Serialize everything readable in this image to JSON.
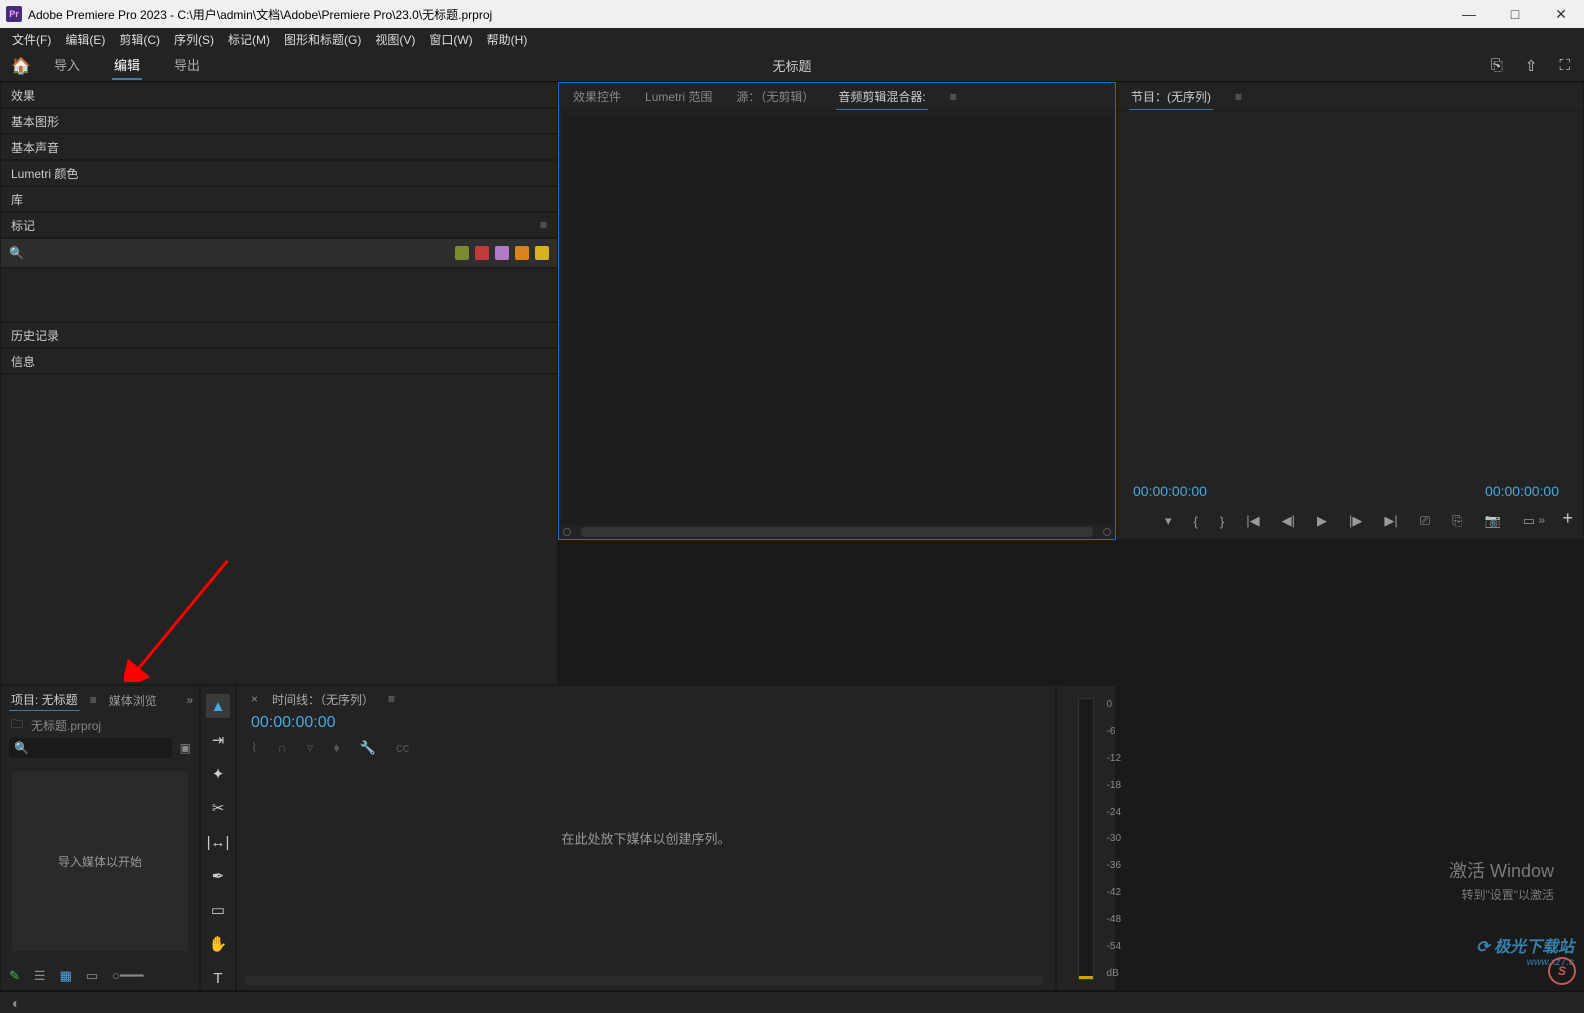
{
  "window": {
    "app_badge": "Pr",
    "title": "Adobe Premiere Pro 2023 - C:\\用户\\admin\\文档\\Adobe\\Premiere Pro\\23.0\\无标题.prproj"
  },
  "menus": [
    "文件(F)",
    "编辑(E)",
    "剪辑(C)",
    "序列(S)",
    "标记(M)",
    "图形和标题(G)",
    "视图(V)",
    "窗口(W)",
    "帮助(H)"
  ],
  "topbar": {
    "tabs": [
      "导入",
      "编辑",
      "导出"
    ],
    "active_index": 1,
    "project_title": "无标题"
  },
  "source_panel": {
    "tabs": [
      "效果控件",
      "Lumetri 范围",
      "源：（无剪辑）",
      "音频剪辑混合器:"
    ],
    "active_index": 3
  },
  "program_panel": {
    "title": "节目：(无序列)",
    "timecode_left": "00:00:00:00",
    "timecode_right": "00:00:00:00"
  },
  "right_panels": {
    "items": [
      "效果",
      "基本图形",
      "基本声音",
      "Lumetri 颜色",
      "库",
      "标记"
    ],
    "markers_colors": [
      "#7a8c2f",
      "#c23b3b",
      "#b37bc7",
      "#d8841a",
      "#d6b21f"
    ],
    "lower": [
      "历史记录",
      "信息"
    ]
  },
  "project_panel": {
    "tabs": [
      "项目: 无标题",
      "媒体浏览"
    ],
    "active_index": 0,
    "file_name": "无标题.prproj",
    "search_placeholder": "",
    "drop_text": "导入媒体以开始"
  },
  "timeline": {
    "title": "时间线：（无序列）",
    "timecode": "00:00:00:00",
    "drop_text": "在此处放下媒体以创建序列。"
  },
  "audio_meter": {
    "ticks": [
      "0",
      "-6",
      "-12",
      "-18",
      "-24",
      "-30",
      "-36",
      "-42",
      "-48",
      "-54",
      "dB"
    ]
  },
  "activation": {
    "line1": "激活 Window",
    "line2": "转到\"设置\"以激活"
  },
  "watermark": {
    "text": "极光下载站",
    "url": "www.xz7.c",
    "badge": "S"
  }
}
